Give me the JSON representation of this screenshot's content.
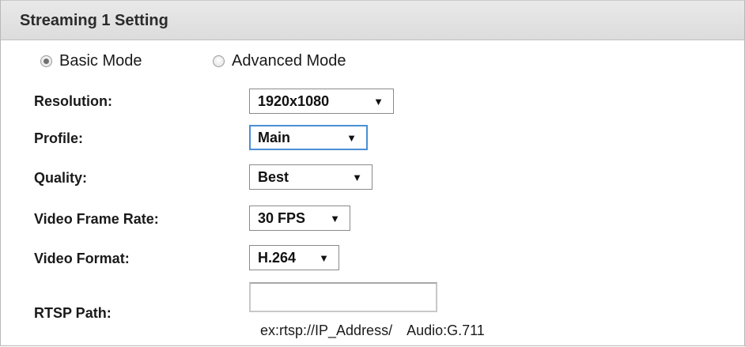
{
  "panel": {
    "title": "Streaming 1 Setting"
  },
  "modes": [
    {
      "label": "Basic Mode",
      "checked": true
    },
    {
      "label": "Advanced Mode",
      "checked": false
    }
  ],
  "fields": {
    "resolution": {
      "label": "Resolution:",
      "value": "1920x1080"
    },
    "profile": {
      "label": "Profile:",
      "value": "Main"
    },
    "quality": {
      "label": "Quality:",
      "value": "Best"
    },
    "frame_rate": {
      "label": "Video Frame Rate:",
      "value": "30 FPS"
    },
    "video_format": {
      "label": "Video Format:",
      "value": "H.264"
    },
    "rtsp_path": {
      "label": "RTSP Path:",
      "value": "",
      "example": "ex:rtsp://IP_Address/",
      "audio_codec": "Audio:G.711"
    }
  },
  "icons": {
    "dropdown_arrow": "▼"
  }
}
